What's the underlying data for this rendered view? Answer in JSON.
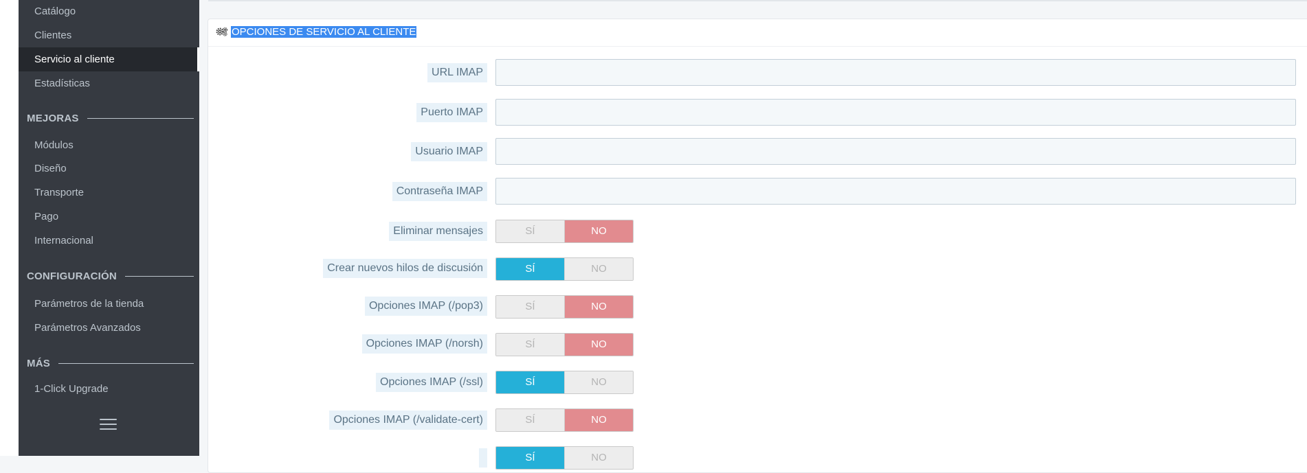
{
  "sidebar": {
    "items_top": [
      {
        "label": "Catálogo"
      },
      {
        "label": "Clientes"
      },
      {
        "label": "Servicio al cliente",
        "active": true
      },
      {
        "label": "Estadísticas"
      }
    ],
    "section_mejoras": "MEJORAS",
    "items_mejoras": [
      {
        "label": "Módulos"
      },
      {
        "label": "Diseño"
      },
      {
        "label": "Transporte"
      },
      {
        "label": "Pago"
      },
      {
        "label": "Internacional"
      }
    ],
    "section_config": "CONFIGURACIÓN",
    "items_config": [
      {
        "label": "Parámetros de la tienda"
      },
      {
        "label": "Parámetros Avanzados"
      }
    ],
    "section_mas": "MÁS",
    "items_mas": [
      {
        "label": "1-Click Upgrade"
      }
    ],
    "menu_icon": "hamburger-icon"
  },
  "panel": {
    "icon": "gears-icon",
    "title": "OPCIONES DE SERVICIO AL CLIENTE"
  },
  "fields": [
    {
      "label": "URL IMAP",
      "value": "",
      "type": "text"
    },
    {
      "label": "Puerto IMAP",
      "value": "",
      "type": "text"
    },
    {
      "label": "Usuario IMAP",
      "value": "",
      "type": "text"
    },
    {
      "label": "Contraseña IMAP",
      "value": "",
      "type": "password"
    }
  ],
  "toggle_labels": {
    "yes": "SÍ",
    "no": "NO"
  },
  "toggles": [
    {
      "label": "Eliminar mensajes",
      "value": "NO"
    },
    {
      "label": "Crear nuevos hilos de discusión",
      "value": "SÍ"
    },
    {
      "label": "Opciones IMAP (/pop3)",
      "value": "NO"
    },
    {
      "label": "Opciones IMAP (/norsh)",
      "value": "NO"
    },
    {
      "label": "Opciones IMAP (/ssl)",
      "value": "SÍ"
    },
    {
      "label": "Opciones IMAP (/validate-cert)",
      "value": "NO"
    },
    {
      "label": "",
      "value": "SÍ"
    }
  ],
  "colors": {
    "sidebar_bg": "#363a41",
    "active_bg": "#25282d",
    "toggle_yes": "#25b0d8",
    "toggle_no": "#e28b8f",
    "selection": "#3b8af0"
  }
}
